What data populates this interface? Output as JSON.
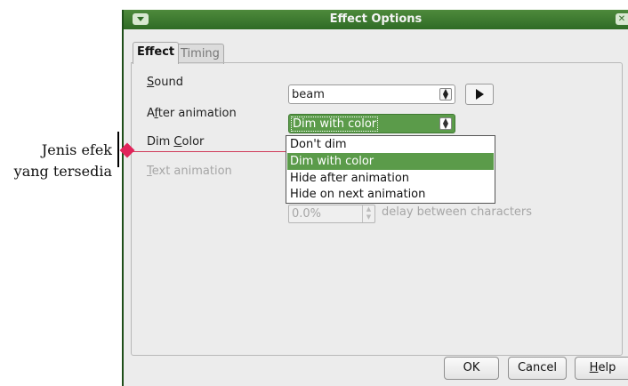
{
  "annotation": {
    "line1": "Jenis efek",
    "line2": "yang tersedia"
  },
  "dialog": {
    "title": "Effect Options",
    "tabs": [
      {
        "label": "Effect",
        "active": true
      },
      {
        "label": "Timing",
        "active": false
      }
    ],
    "fields": {
      "sound": {
        "label_prefix": "",
        "label_mnemonic": "S",
        "label_rest": "ound",
        "value": "beam"
      },
      "after_animation": {
        "label_prefix": "A",
        "label_mnemonic": "f",
        "label_rest": "ter animation",
        "value": "Dim with color"
      },
      "dim_color": {
        "label_prefix": "Dim ",
        "label_mnemonic": "C",
        "label_rest": "olor"
      },
      "text_animation": {
        "label_prefix": "",
        "label_mnemonic": "T",
        "label_rest": "ext animation"
      },
      "delay": {
        "value": "0.0%",
        "label": "delay between characters"
      }
    },
    "dropdown_options": [
      "Don't dim",
      "Dim with color",
      "Hide after animation",
      "Hide on next animation"
    ],
    "selected_option": "Dim with color",
    "buttons": {
      "ok": "OK",
      "cancel": "Cancel",
      "help_mnemonic": "H",
      "help_rest": "elp"
    }
  },
  "colors": {
    "titlebar": "#2f6b25",
    "selection": "#5b9b4a",
    "annotation_marker": "#e0245a"
  }
}
